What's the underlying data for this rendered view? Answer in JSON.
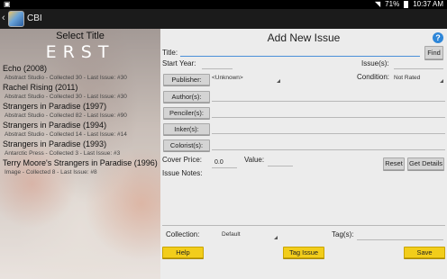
{
  "status_bar": {
    "battery": "71%",
    "time": "10:37 AM",
    "wifi_icon": "wifi-icon",
    "battery_icon": "battery-icon"
  },
  "action_bar": {
    "back": "‹",
    "title": "CBI"
  },
  "left_panel": {
    "header": "Select Title",
    "cover_letters": "ERST",
    "titles": [
      {
        "name": "Echo (2008)",
        "detail": "Abstract Studio - Collected 30 - Last Issue: #30"
      },
      {
        "name": "Rachel Rising (2011)",
        "detail": "Abstract Studio - Collected 30 - Last Issue: #30"
      },
      {
        "name": "Strangers in Paradise (1997)",
        "detail": "Abstract Studio - Collected 82 - Last Issue: #90"
      },
      {
        "name": "Strangers in Paradise (1994)",
        "detail": "Abstract Studio - Collected 14 - Last Issue: #14"
      },
      {
        "name": "Strangers in Paradise (1993)",
        "detail": "Antarctic Press - Collected 3 - Last Issue: #3"
      },
      {
        "name": "Terry Moore's Strangers in Paradise (1996)",
        "detail": "Image - Collected 8 - Last Issue: #8"
      }
    ]
  },
  "form": {
    "heading": "Add New Issue",
    "help_icon_text": "?",
    "title_label": "Title:",
    "find_button": "Find",
    "start_year_label": "Start Year:",
    "issues_label": "Issue(s):",
    "publisher_button": "Publisher:",
    "publisher_value": "<Unknown>",
    "condition_label": "Condition:",
    "condition_value": "Not Rated",
    "authors_button": "Author(s):",
    "pencilers_button": "Penciler(s):",
    "inkers_button": "Inker(s):",
    "colorists_button": "Colorist(s):",
    "cover_price_label": "Cover Price:",
    "cover_price_value": "0.0",
    "value_label": "Value:",
    "reset_button": "Reset",
    "get_details_button": "Get Details",
    "issue_notes_label": "Issue Notes:",
    "collection_label": "Collection:",
    "collection_value": "Default",
    "tags_label": "Tag(s):",
    "help_button": "Help",
    "tag_issue_button": "Tag Issue",
    "save_button": "Save"
  },
  "colors": {
    "accent_blue": "#2e86d8",
    "button_yellow": "#f2cd1b",
    "status_bar": "#000000",
    "action_bar": "#1b1b1b"
  }
}
